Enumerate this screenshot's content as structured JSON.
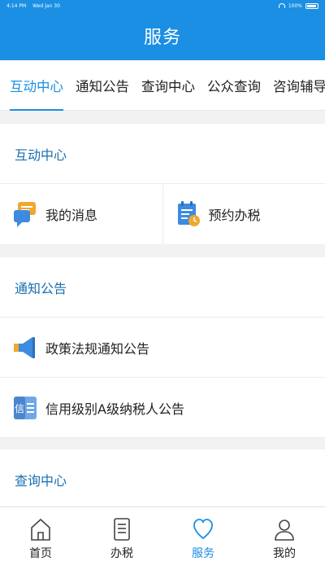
{
  "status_bar": {
    "time": "4:14 PM",
    "date": "Wed Jan 30",
    "battery": "100%"
  },
  "header": {
    "title": "服务"
  },
  "tabs": [
    {
      "label": "互动中心",
      "active": true
    },
    {
      "label": "通知公告",
      "active": false
    },
    {
      "label": "查询中心",
      "active": false
    },
    {
      "label": "公众查询",
      "active": false
    },
    {
      "label": "咨询辅导",
      "active": false
    }
  ],
  "interaction": {
    "title": "互动中心",
    "items": [
      {
        "label": "我的消息",
        "icon": "chat-bubbles-icon"
      },
      {
        "label": "预约办税",
        "icon": "calendar-clock-icon"
      }
    ]
  },
  "notices": {
    "title": "通知公告",
    "items": [
      {
        "label": "政策法规通知公告",
        "icon": "megaphone-icon"
      },
      {
        "label": "信用级别A级纳税人公告",
        "icon": "credit-badge-icon",
        "icon_text": "信"
      }
    ]
  },
  "query": {
    "title": "查询中心"
  },
  "bottom_nav": [
    {
      "label": "首页",
      "icon": "home-icon",
      "active": false
    },
    {
      "label": "办税",
      "icon": "document-icon",
      "active": false
    },
    {
      "label": "服务",
      "icon": "heart-icon",
      "active": true
    },
    {
      "label": "我的",
      "icon": "user-icon",
      "active": false
    }
  ],
  "colors": {
    "primary": "#1a8fe3",
    "section_title": "#1a6fb0",
    "background": "#f2f2f2"
  }
}
